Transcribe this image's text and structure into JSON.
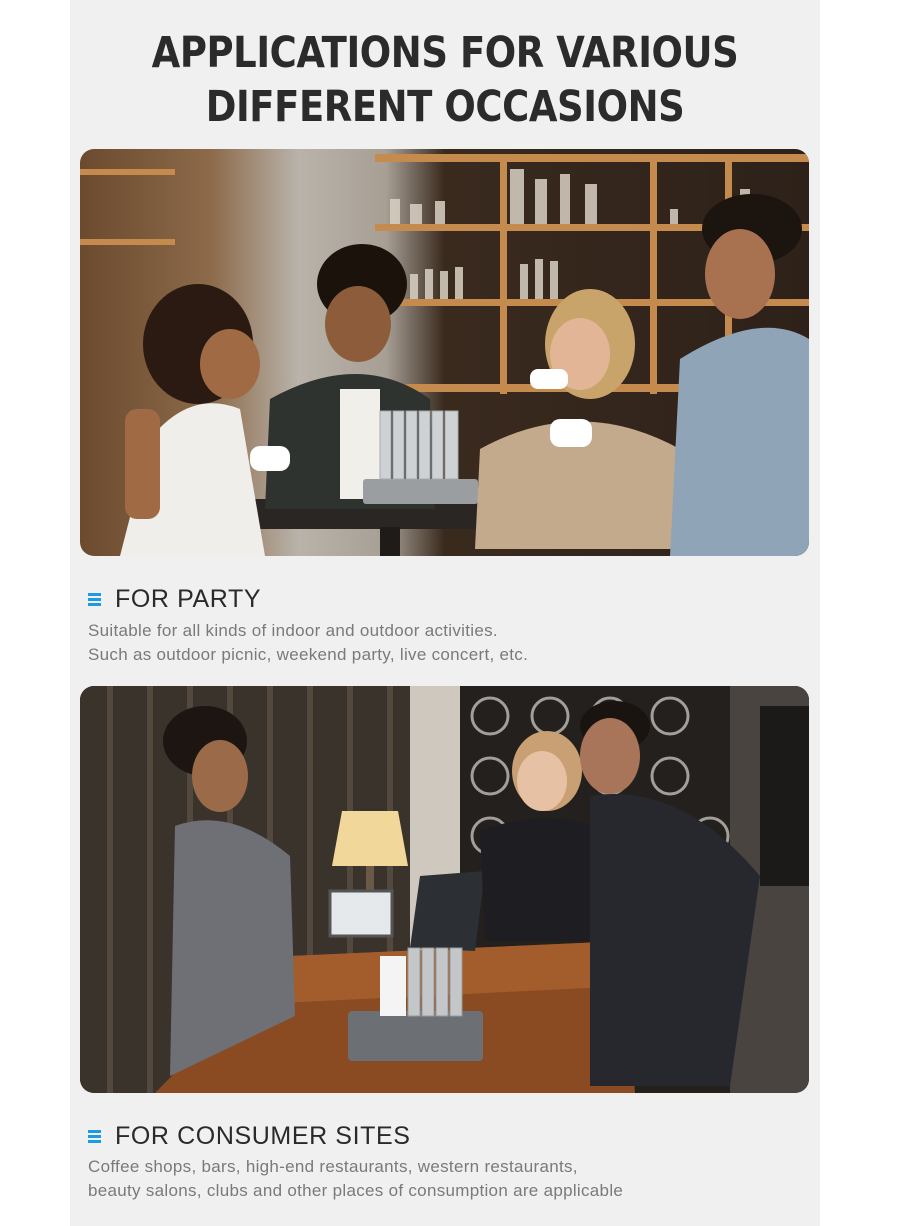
{
  "title": {
    "line1": "APPLICATIONS FOR VARIOUS",
    "line2": "DIFFERENT OCCASIONS"
  },
  "sections": [
    {
      "heading": "FOR PARTY",
      "icon": "menu-lines-icon",
      "lines": [
        "Suitable for all kinds of indoor and outdoor activities.",
        "Such as outdoor picnic, weekend party, live concert, etc."
      ]
    },
    {
      "heading": "FOR CONSUMER SITES",
      "icon": "menu-lines-icon",
      "lines": [
        "Coffee shops, bars, high-end restaurants, western restaurants,",
        "beauty salons, clubs and other places of consumption are applicable"
      ]
    }
  ],
  "colors": {
    "accent": "#1e9be0",
    "panel": "#f0f0f0",
    "heading": "#2b2b2b",
    "body_text": "#7a7a7a"
  }
}
